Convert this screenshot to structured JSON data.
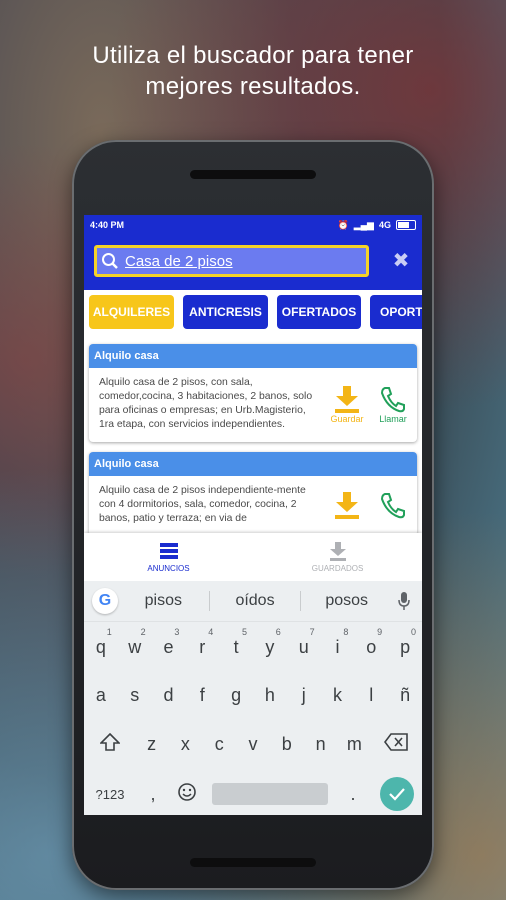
{
  "headline": {
    "line1": "Utiliza el buscador para tener",
    "line2": "mejores resultados."
  },
  "status": {
    "time": "4:40 PM",
    "network": "4G"
  },
  "search": {
    "value": "Casa de 2 pisos"
  },
  "tabs": [
    {
      "label": "ALQUILERES",
      "active": true
    },
    {
      "label": "ANTICRESIS",
      "active": false
    },
    {
      "label": "OFERTADOS",
      "active": false
    },
    {
      "label": "OPORTU",
      "active": false
    }
  ],
  "listings": [
    {
      "title": "Alquilo casa",
      "text": "Alquilo casa de 2 pisos, con sala, comedor,cocina, 3 habitaciones, 2 banos, solo para oficinas o empresas; en Urb.Magisterio, 1ra etapa, con servicios independientes."
    },
    {
      "title": "Alquilo casa",
      "text": "Alquilo casa de 2 pisos independiente-mente con 4 dormitorios, sala, comedor, cocina, 2 banos, patio y terraza; en via de"
    }
  ],
  "actions": {
    "save": "Guardar",
    "call": "Llamar"
  },
  "bottom_nav": {
    "ads": "ANUNCIOS",
    "saved": "GUARDADOS"
  },
  "suggestions": [
    "pisos",
    "oídos",
    "posos"
  ],
  "keyboard": {
    "row1": [
      [
        "q",
        "1"
      ],
      [
        "w",
        "2"
      ],
      [
        "e",
        "3"
      ],
      [
        "r",
        "4"
      ],
      [
        "t",
        "5"
      ],
      [
        "y",
        "6"
      ],
      [
        "u",
        "7"
      ],
      [
        "i",
        "8"
      ],
      [
        "o",
        "9"
      ],
      [
        "p",
        "0"
      ]
    ],
    "row2": [
      "a",
      "s",
      "d",
      "f",
      "g",
      "h",
      "j",
      "k",
      "l",
      "ñ"
    ],
    "row3": [
      "z",
      "x",
      "c",
      "v",
      "b",
      "n",
      "m"
    ],
    "sym": "?123",
    "comma": ",",
    "period": "."
  },
  "colors": {
    "primary": "#1a2ccf",
    "accent": "#f7c61a",
    "card_header": "#4a8fe8",
    "call": "#21a05a"
  }
}
